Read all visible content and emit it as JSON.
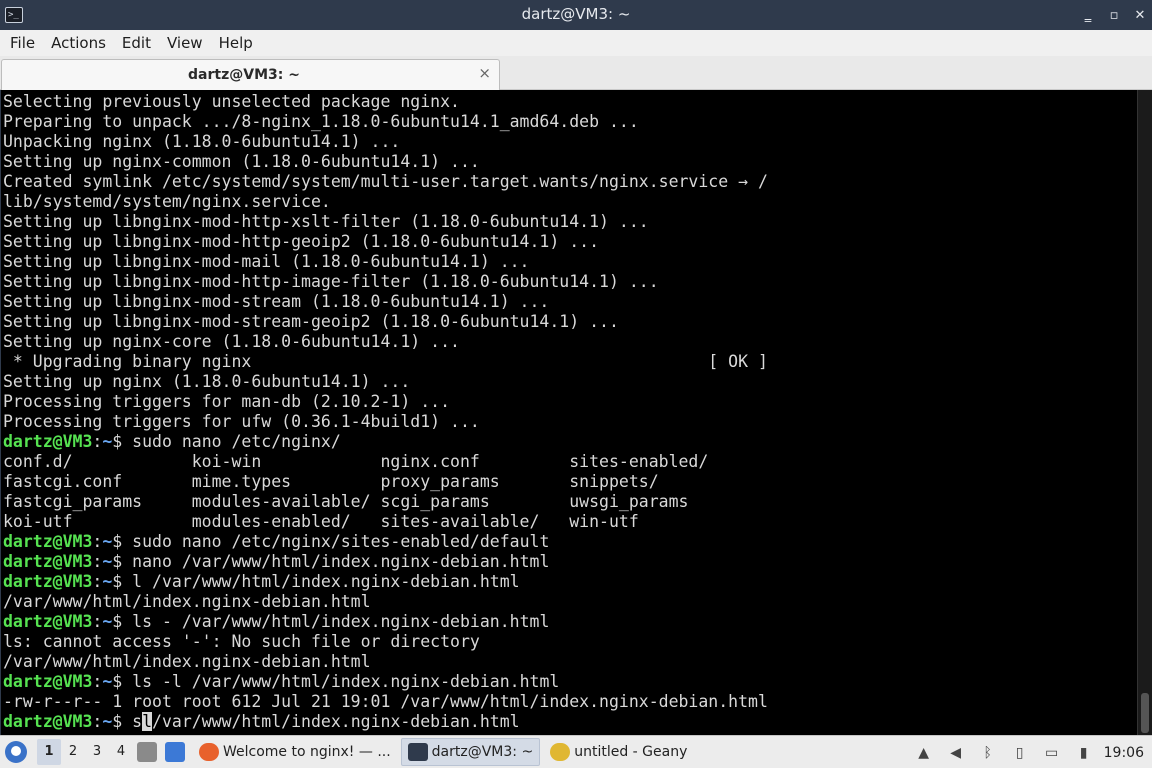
{
  "window": {
    "title": "dartz@VM3: ~",
    "app_icon_glyph": ">_",
    "minimize_glyph": "‗",
    "maximize_glyph": "▫",
    "close_glyph": "✕"
  },
  "menu": [
    "File",
    "Actions",
    "Edit",
    "View",
    "Help"
  ],
  "tab": {
    "label": "dartz@VM3: ~",
    "close_glyph": "×"
  },
  "prompt": {
    "user_host": "dartz@VM3",
    "sep": ":",
    "path": "~",
    "sym": "$ "
  },
  "terminal": {
    "lines": [
      {
        "t": "out",
        "text": "Selecting previously unselected package nginx."
      },
      {
        "t": "out",
        "text": "Preparing to unpack .../8-nginx_1.18.0-6ubuntu14.1_amd64.deb ..."
      },
      {
        "t": "out",
        "text": "Unpacking nginx (1.18.0-6ubuntu14.1) ..."
      },
      {
        "t": "out",
        "text": "Setting up nginx-common (1.18.0-6ubuntu14.1) ..."
      },
      {
        "t": "out",
        "text": "Created symlink /etc/systemd/system/multi-user.target.wants/nginx.service → /"
      },
      {
        "t": "out",
        "text": "lib/systemd/system/nginx.service."
      },
      {
        "t": "out",
        "text": "Setting up libnginx-mod-http-xslt-filter (1.18.0-6ubuntu14.1) ..."
      },
      {
        "t": "out",
        "text": "Setting up libnginx-mod-http-geoip2 (1.18.0-6ubuntu14.1) ..."
      },
      {
        "t": "out",
        "text": "Setting up libnginx-mod-mail (1.18.0-6ubuntu14.1) ..."
      },
      {
        "t": "out",
        "text": "Setting up libnginx-mod-http-image-filter (1.18.0-6ubuntu14.1) ..."
      },
      {
        "t": "out",
        "text": "Setting up libnginx-mod-stream (1.18.0-6ubuntu14.1) ..."
      },
      {
        "t": "out",
        "text": "Setting up libnginx-mod-stream-geoip2 (1.18.0-6ubuntu14.1) ..."
      },
      {
        "t": "out",
        "text": "Setting up nginx-core (1.18.0-6ubuntu14.1) ..."
      },
      {
        "t": "out",
        "text": " * Upgrading binary nginx                                              [ OK ]"
      },
      {
        "t": "out",
        "text": "Setting up nginx (1.18.0-6ubuntu14.1) ..."
      },
      {
        "t": "out",
        "text": "Processing triggers for man-db (2.10.2-1) ..."
      },
      {
        "t": "out",
        "text": "Processing triggers for ufw (0.36.1-4build1) ..."
      },
      {
        "t": "cmd",
        "text": "sudo nano /etc/nginx/"
      },
      {
        "t": "out",
        "text": "conf.d/            koi-win            nginx.conf         sites-enabled/"
      },
      {
        "t": "out",
        "text": "fastcgi.conf       mime.types         proxy_params       snippets/"
      },
      {
        "t": "out",
        "text": "fastcgi_params     modules-available/ scgi_params        uwsgi_params"
      },
      {
        "t": "out",
        "text": "koi-utf            modules-enabled/   sites-available/   win-utf"
      },
      {
        "t": "cmd",
        "text": "sudo nano /etc/nginx/sites-enabled/default"
      },
      {
        "t": "cmd",
        "text": "nano /var/www/html/index.nginx-debian.html"
      },
      {
        "t": "cmd",
        "text": "l /var/www/html/index.nginx-debian.html"
      },
      {
        "t": "out",
        "text": "/var/www/html/index.nginx-debian.html"
      },
      {
        "t": "cmd",
        "text": "ls - /var/www/html/index.nginx-debian.html"
      },
      {
        "t": "out",
        "text": "ls: cannot access '-': No such file or directory"
      },
      {
        "t": "out",
        "text": "/var/www/html/index.nginx-debian.html"
      },
      {
        "t": "cmd",
        "text": "ls -l /var/www/html/index.nginx-debian.html"
      },
      {
        "t": "out",
        "text": "-rw-r--r-- 1 root root 612 Jul 21 19:01 /var/www/html/index.nginx-debian.html"
      },
      {
        "t": "active",
        "before": "s",
        "cursor": "l",
        "after": "/var/www/html/index.nginx-debian.html"
      }
    ]
  },
  "taskbar": {
    "workspaces": [
      "1",
      "2",
      "3",
      "4"
    ],
    "tasks": [
      {
        "label": "Welcome to nginx! — ...",
        "icon": "firefox-icon",
        "color": "#e8612c"
      },
      {
        "label": "dartz@VM3: ~",
        "icon": "terminal-icon",
        "color": "#2f3a4c"
      },
      {
        "label": "untitled - Geany",
        "icon": "geany-icon",
        "color": "#e0b732"
      }
    ],
    "clock": "19:06"
  }
}
